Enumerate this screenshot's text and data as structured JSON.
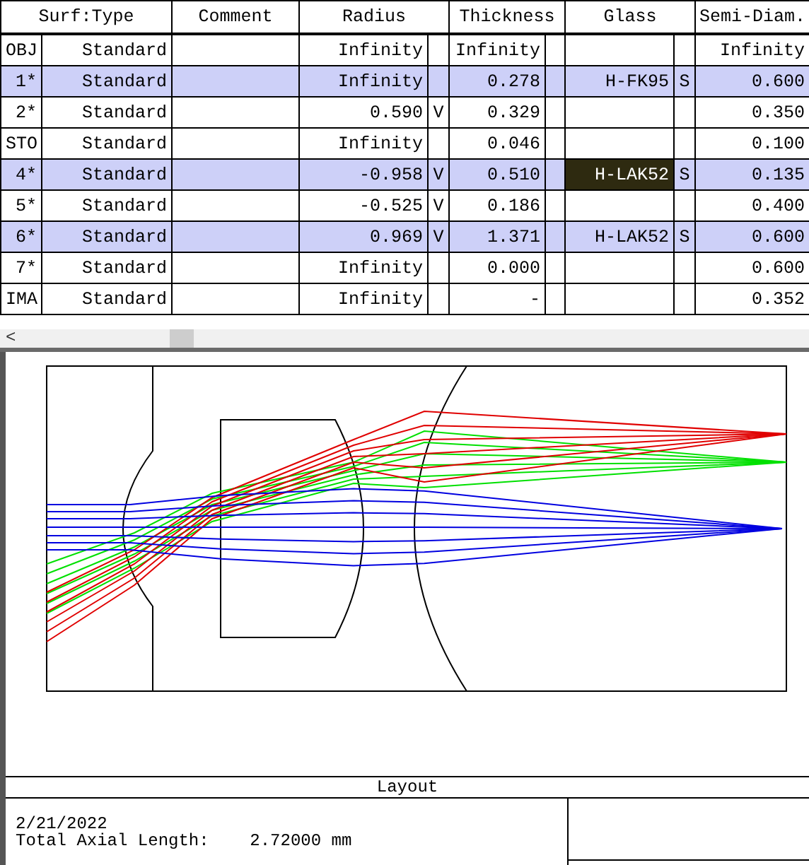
{
  "table": {
    "columns": [
      "Surf:Type",
      "Comment",
      "Radius",
      "Thickness",
      "Glass",
      "Semi-Diam."
    ],
    "rows": [
      {
        "surface": "OBJ",
        "type": "Standard",
        "radius": "Infinity",
        "thickness": "Infinity",
        "semi_diameter": "Infinity",
        "selected": false,
        "glass_focused": false
      },
      {
        "surface": "1*",
        "type": "Standard",
        "radius": "Infinity",
        "thickness": "0.278",
        "glass": "H-FK95",
        "glass_solve": "S",
        "semi_diameter": "0.600",
        "selected": true,
        "glass_focused": false
      },
      {
        "surface": "2*",
        "type": "Standard",
        "radius": "0.590",
        "radius_solve": "V",
        "thickness": "0.329",
        "semi_diameter": "0.350",
        "selected": false,
        "glass_focused": false
      },
      {
        "surface": "STO",
        "type": "Standard",
        "radius": "Infinity",
        "thickness": "0.046",
        "semi_diameter": "0.100",
        "selected": false,
        "glass_focused": false
      },
      {
        "surface": "4*",
        "type": "Standard",
        "radius": "-0.958",
        "radius_solve": "V",
        "thickness": "0.510",
        "glass": "H-LAK52",
        "glass_solve": "S",
        "semi_diameter": "0.135",
        "selected": true,
        "glass_focused": true
      },
      {
        "surface": "5*",
        "type": "Standard",
        "radius": "-0.525",
        "radius_solve": "V",
        "thickness": "0.186",
        "semi_diameter": "0.400",
        "selected": false,
        "glass_focused": false
      },
      {
        "surface": "6*",
        "type": "Standard",
        "radius": "0.969",
        "radius_solve": "V",
        "thickness": "1.371",
        "glass": "H-LAK52",
        "glass_solve": "S",
        "semi_diameter": "0.600",
        "selected": true,
        "glass_focused": false
      },
      {
        "surface": "7*",
        "type": "Standard",
        "radius": "Infinity",
        "thickness": "0.000",
        "semi_diameter": "0.600",
        "selected": false,
        "glass_focused": false
      },
      {
        "surface": "IMA",
        "type": "Standard",
        "radius": "Infinity",
        "thickness": "-",
        "semi_diameter": "0.352",
        "selected": false,
        "glass_focused": false
      }
    ]
  },
  "scrollbar": {
    "left_arrow": "<"
  },
  "layout": {
    "title": "Layout",
    "date": "2/21/2022",
    "axial_length_label": "Total Axial Length:",
    "axial_length_value": "2.72000 mm"
  }
}
